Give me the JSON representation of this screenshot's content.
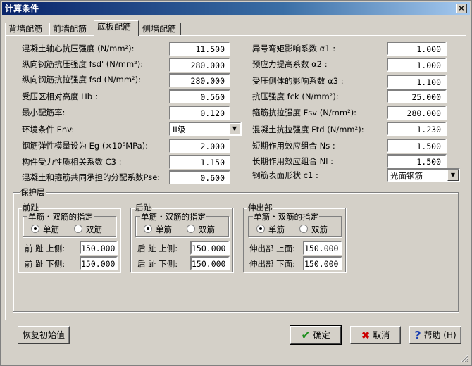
{
  "window": {
    "title": "计算条件",
    "close": "×"
  },
  "tabs": [
    "背墙配筋",
    "前墙配筋",
    "底板配筋",
    "侧墙配筋"
  ],
  "left_params": [
    {
      "label": "混凝土轴心抗压强度 (N/mm²):",
      "value": "11.500"
    },
    {
      "label": "纵向钢筋抗压强度 fsd' (N/mm²):",
      "value": "280.000"
    },
    {
      "label": "纵向钢筋抗拉强度 fsd (N/mm²):",
      "value": "280.000"
    },
    {
      "label": "受压区相对高度 Hb :",
      "value": "0.560"
    },
    {
      "label": "最小配筋率:",
      "value": "0.120"
    },
    {
      "label": "环境条件 Env:",
      "value": "II级"
    },
    {
      "label": "钢筋弹性模量设为 Eg (×10⁵MPa):",
      "value": "2.000"
    },
    {
      "label": "构件受力性质相关系数 C3 :",
      "value": "1.150"
    },
    {
      "label": "混凝土和箍筋共同承担的分配系数Pse:",
      "value": "0.600"
    }
  ],
  "right_params": [
    {
      "label": "异号弯矩影响系数 α1 :",
      "value": "1.000"
    },
    {
      "label": "预应力提高系数 α2 :",
      "value": "1.000"
    },
    {
      "label": "受压侧体的影响系数 α3 :",
      "value": "1.100"
    },
    {
      "label": "抗压强度 fck (N/mm²):",
      "value": "25.000"
    },
    {
      "label": "箍筋抗拉强度 Fsv (N/mm²):",
      "value": "280.000"
    },
    {
      "label": "混凝土抗拉强度 Ftd (N/mm²):",
      "value": "1.230"
    },
    {
      "label": "短期作用效应组合 Ns :",
      "value": "1.500"
    },
    {
      "label": "长期作用效应组合 Nl :",
      "value": "1.500"
    },
    {
      "label": "钢筋表面形状 c1 :",
      "value": "光面钢筋"
    }
  ],
  "cover": {
    "title": "保护层",
    "groups": [
      {
        "title": "前趾",
        "spec_title": "单筋・双筋的指定",
        "single": "单筋",
        "double": "双筋",
        "selected": "single",
        "top_label": "前 趾 上侧:",
        "top_value": "150.000",
        "bottom_label": "前 趾 下侧:",
        "bottom_value": "150.000"
      },
      {
        "title": "后趾",
        "spec_title": "单筋・双筋的指定",
        "single": "单筋",
        "double": "双筋",
        "selected": "single",
        "top_label": "后 趾 上侧:",
        "top_value": "150.000",
        "bottom_label": "后 趾 下侧:",
        "bottom_value": "150.000"
      },
      {
        "title": "伸出部",
        "spec_title": "单筋・双筋的指定",
        "single": "单筋",
        "double": "双筋",
        "selected": "single",
        "top_label": "伸出部 上面:",
        "top_value": "150.000",
        "bottom_label": "伸出部 下面:",
        "bottom_value": "150.000"
      }
    ]
  },
  "buttons": {
    "reset": "恢复初始值",
    "ok": "确定",
    "cancel": "取消",
    "help": "帮助 (H)"
  },
  "colors": {
    "title_start": "#0a246a",
    "title_end": "#a6caf0",
    "face": "#d4d0c8",
    "ok_check": "#1f8f1f",
    "cancel_x": "#cc0000",
    "help_q": "#1a3fb0"
  }
}
